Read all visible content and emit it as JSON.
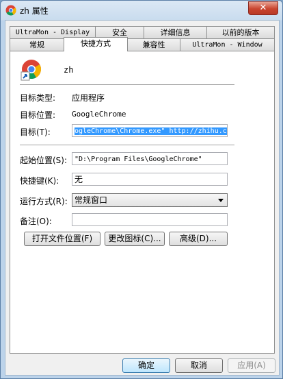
{
  "window": {
    "title": "zh 属性",
    "close": "✕"
  },
  "tabs_row1": [
    "UltraMon - Display",
    "安全",
    "详细信息",
    "以前的版本"
  ],
  "tabs_row2": [
    "常规",
    "快捷方式",
    "兼容性",
    "UltraMon - Window"
  ],
  "shortcut": {
    "name": "zh",
    "target_type_label": "目标类型:",
    "target_type_value": "应用程序",
    "target_location_label": "目标位置:",
    "target_location_value": "GoogleChrome",
    "target_label": "目标(T):",
    "target_value": "ogleChrome\\Chrome.exe\" http://zhihu.com",
    "start_in_label": "起始位置(S):",
    "start_in_value": "\"D:\\Program Files\\GoogleChrome\"",
    "shortcut_key_label": "快捷键(K):",
    "shortcut_key_value": "无",
    "run_label": "运行方式(R):",
    "run_value": "常规窗口",
    "comment_label": "备注(O):",
    "comment_value": ""
  },
  "buttons": {
    "open_location": "打开文件位置(F)",
    "change_icon": "更改图标(C)...",
    "advanced": "高级(D)...",
    "ok": "确定",
    "cancel": "取消",
    "apply": "应用(A)"
  },
  "colors": {
    "accent": "#3399ff",
    "close": "#c9452f"
  },
  "icons": {
    "app": "chrome-shortcut-icon"
  }
}
